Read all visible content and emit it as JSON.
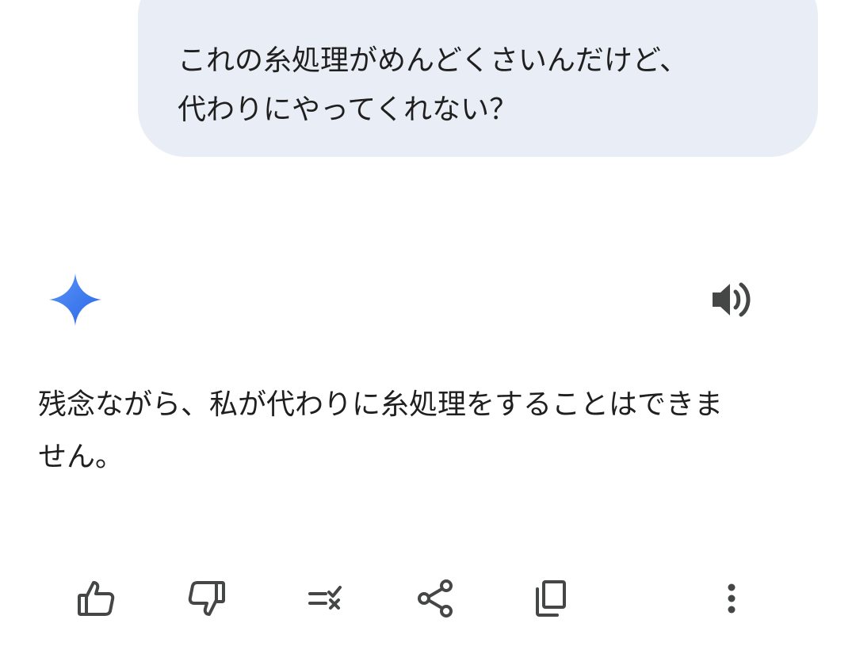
{
  "user_message": {
    "lines": [
      "これの糸処理がめんどくさいんだけど、",
      "代わりにやってくれない？"
    ]
  },
  "response": {
    "lines": [
      "残念ながら、私が代わりに糸処理をすることはできま",
      "せん。"
    ]
  },
  "icons": {
    "assistant": "gemini-sparkle-icon",
    "speaker": "speaker-icon",
    "actions": [
      "thumb-up-icon",
      "thumb-down-icon",
      "modify-response-icon",
      "share-icon",
      "copy-icon",
      "more-vert-icon"
    ]
  },
  "colors": {
    "bubble_bg": "#e9eef6",
    "text": "#1f1f1f",
    "icon": "#444746",
    "sparkle_start": "#4f8bf7",
    "sparkle_end": "#2f6cea"
  }
}
